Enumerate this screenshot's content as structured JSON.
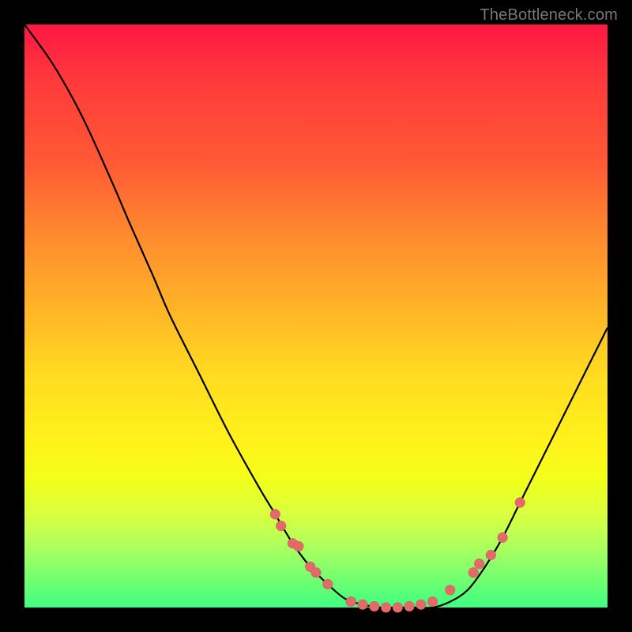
{
  "attribution": "TheBottleneck.com",
  "colors": {
    "background": "#000000",
    "dot": "#e46a6a",
    "curve": "#000000",
    "gradient_top": "#ff1744",
    "gradient_bottom": "#3fff80"
  },
  "chart_data": {
    "type": "line",
    "title": "",
    "xlabel": "",
    "ylabel": "",
    "xlim": [
      0,
      100
    ],
    "ylim": [
      0,
      100
    ],
    "x": [
      0,
      5,
      10,
      15,
      18,
      22,
      25,
      30,
      35,
      40,
      43,
      46,
      49,
      52,
      55,
      58,
      61,
      64,
      67,
      70,
      73,
      76,
      79,
      82,
      85,
      88,
      91,
      94,
      97,
      100
    ],
    "y": [
      100,
      93,
      84,
      73,
      66,
      57,
      50,
      40,
      30,
      21,
      16,
      11,
      7,
      4,
      1.5,
      0.5,
      0,
      0,
      0,
      0,
      1,
      3,
      7,
      12,
      18,
      24,
      30,
      36,
      42,
      48
    ],
    "scatter_points": [
      {
        "x": 43,
        "y": 16
      },
      {
        "x": 44,
        "y": 14
      },
      {
        "x": 46,
        "y": 11
      },
      {
        "x": 47,
        "y": 10.5
      },
      {
        "x": 49,
        "y": 7
      },
      {
        "x": 50,
        "y": 6
      },
      {
        "x": 52,
        "y": 4
      },
      {
        "x": 56,
        "y": 1
      },
      {
        "x": 58,
        "y": 0.5
      },
      {
        "x": 60,
        "y": 0.2
      },
      {
        "x": 62,
        "y": 0
      },
      {
        "x": 64,
        "y": 0
      },
      {
        "x": 66,
        "y": 0.2
      },
      {
        "x": 68,
        "y": 0.5
      },
      {
        "x": 70,
        "y": 1
      },
      {
        "x": 73,
        "y": 3
      },
      {
        "x": 77,
        "y": 6
      },
      {
        "x": 78,
        "y": 7.5
      },
      {
        "x": 80,
        "y": 9
      },
      {
        "x": 82,
        "y": 12
      },
      {
        "x": 85,
        "y": 18
      }
    ]
  }
}
